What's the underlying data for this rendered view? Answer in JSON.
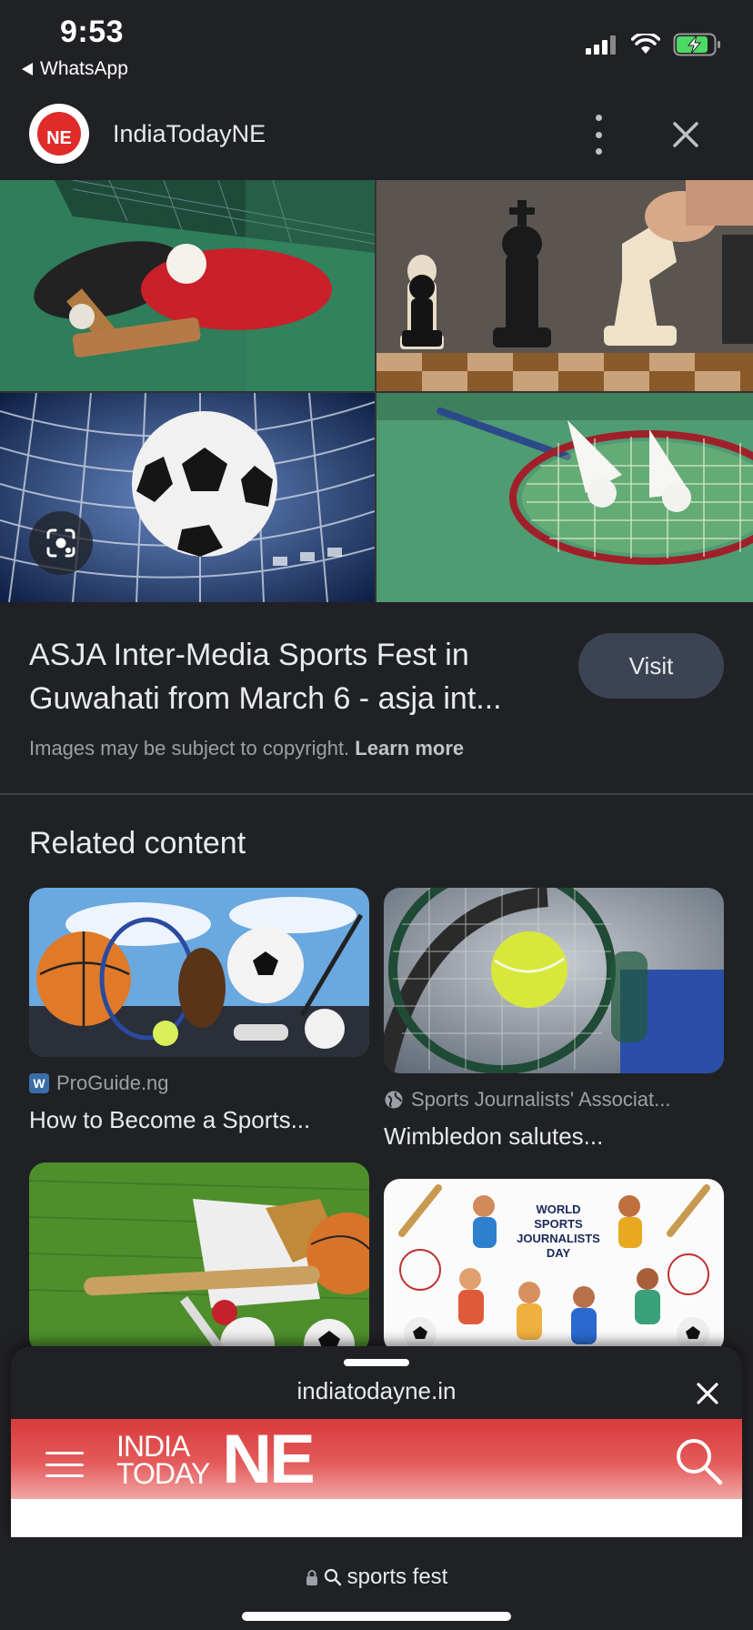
{
  "status_bar": {
    "time": "9:53",
    "back_app": "WhatsApp",
    "icons": [
      "signal-icon",
      "wifi-icon",
      "battery-charging-icon"
    ]
  },
  "header": {
    "logo_text": "NE",
    "site_name": "IndiaTodayNE"
  },
  "collage": {
    "tiles": [
      "table-tennis",
      "chess",
      "football",
      "badminton"
    ]
  },
  "result": {
    "title_line1": "ASJA Inter-Media Sports Fest in",
    "title_line2": "Guwahati from March 6 - asja int...",
    "visit_label": "Visit",
    "copyright_text": "Images may be subject to copyright.",
    "learn_more": "Learn more"
  },
  "related": {
    "heading": "Related content",
    "cards": [
      {
        "source": "ProGuide.ng",
        "caption": "How to Become a Sports...",
        "icon": "wordpress-icon"
      },
      {
        "source": "Sports Journalists' Associat...",
        "caption": "Wimbledon salutes...",
        "icon": "globe-icon"
      },
      {
        "source": "",
        "caption": "",
        "icon": ""
      },
      {
        "source": "",
        "caption": "",
        "icon": "",
        "image_text": [
          "WORLD",
          "SPORTS",
          "JOURNALISTS",
          "DAY"
        ]
      }
    ]
  },
  "sheet": {
    "url": "indiatodayne.in",
    "brand_small_1": "INDIA",
    "brand_small_2": "TODAY",
    "brand_big": "NE"
  },
  "urlbar": {
    "query": "sports fest"
  },
  "colors": {
    "background": "#202124",
    "visit_button": "#3c4353",
    "brand_red": "#d93b3b"
  }
}
